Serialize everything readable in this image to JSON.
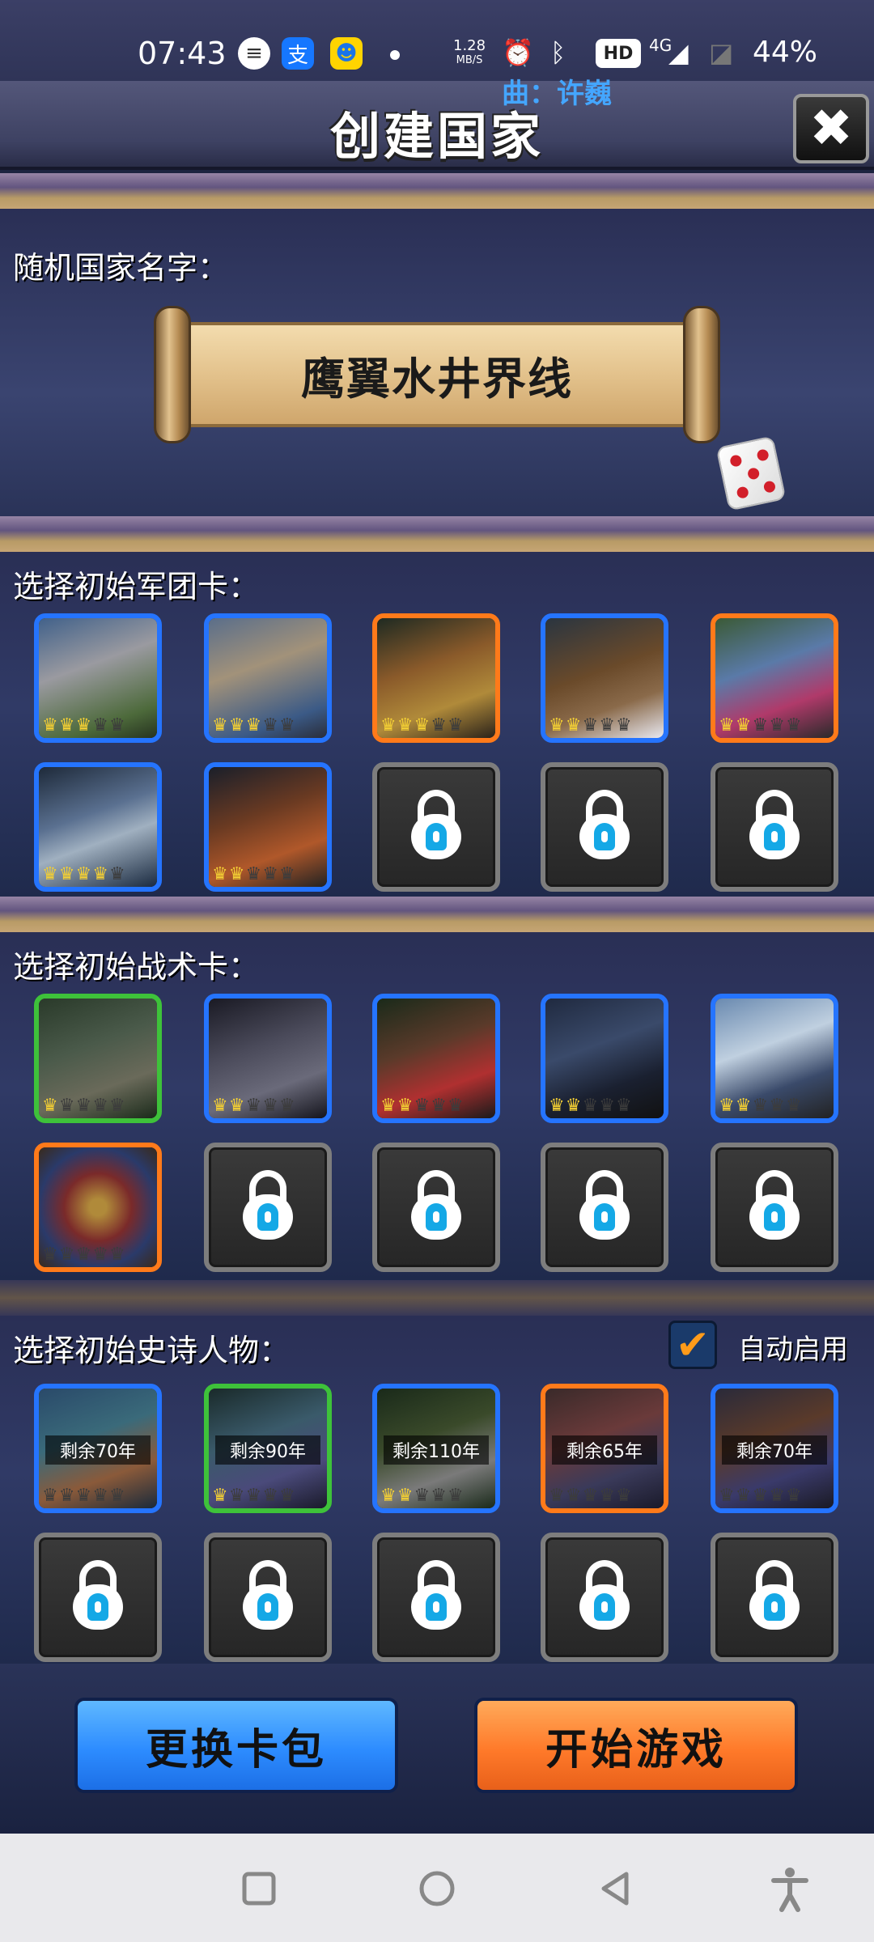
{
  "status_bar": {
    "time": "07:43",
    "speed_value": "1.28",
    "speed_unit": "MB/S",
    "network": "4G",
    "hd": "HD",
    "battery": "44%",
    "app_icons": [
      "message-icon",
      "alipay-icon",
      "qq-icon"
    ]
  },
  "music": "曲：许巍",
  "title": "创建国家",
  "close_label": "✖",
  "name_section": {
    "label": "随机国家名字：",
    "country_name": "鹰翼水井界线"
  },
  "legion_section": {
    "label": "选择初始军团卡：",
    "cards": [
      {
        "rarity": "blue",
        "crowns": 3,
        "art": "knight-on-horse"
      },
      {
        "rarity": "blue",
        "crowns": 3,
        "art": "armored-soldier"
      },
      {
        "rarity": "orange",
        "crowns": 3,
        "art": "cavalry-rider"
      },
      {
        "rarity": "blue",
        "crowns": 2,
        "art": "catapult"
      },
      {
        "rarity": "orange",
        "crowns": 2,
        "art": "archer"
      },
      {
        "rarity": "blue",
        "crowns": 4,
        "art": "dark-warrior"
      },
      {
        "rarity": "blue",
        "crowns": 2,
        "art": "chariot"
      },
      {
        "locked": true
      },
      {
        "locked": true
      },
      {
        "locked": true
      }
    ]
  },
  "tactic_section": {
    "label": "选择初始战术卡：",
    "cards": [
      {
        "rarity": "green",
        "crowns": 1,
        "art": "knights-group"
      },
      {
        "rarity": "blue",
        "crowns": 2,
        "art": "dark-army"
      },
      {
        "rarity": "blue",
        "crowns": 2,
        "art": "barbarian-warrior"
      },
      {
        "rarity": "blue",
        "crowns": 2,
        "art": "soldier-ranks"
      },
      {
        "rarity": "blue",
        "crowns": 2,
        "art": "spear-army"
      },
      {
        "rarity": "orange",
        "crowns": 0,
        "art": "shield"
      },
      {
        "locked": true
      },
      {
        "locked": true
      },
      {
        "locked": true
      },
      {
        "locked": true
      }
    ]
  },
  "hero_section": {
    "label": "选择初始史诗人物：",
    "auto_enable_label": "自动启用",
    "auto_enable_checked": true,
    "cards": [
      {
        "rarity": "blue",
        "crowns": 0,
        "remain": "剩余70年",
        "art": "red-hair-hero"
      },
      {
        "rarity": "green",
        "crowns": 1,
        "remain": "剩余90年",
        "art": "elf-mage"
      },
      {
        "rarity": "blue",
        "crowns": 2,
        "remain": "剩余110年",
        "art": "knight-hero"
      },
      {
        "rarity": "orange",
        "crowns": 0,
        "remain": "剩余65年",
        "art": "general"
      },
      {
        "rarity": "blue",
        "crowns": 0,
        "remain": "剩余70年",
        "art": "warlord"
      },
      {
        "locked": true
      },
      {
        "locked": true
      },
      {
        "locked": true
      },
      {
        "locked": true
      },
      {
        "locked": true
      }
    ]
  },
  "buttons": {
    "change_pack": "更换卡包",
    "start_game": "开始游戏"
  },
  "colors": {
    "blue_rarity": "#2574ff",
    "orange_rarity": "#ff7a1a",
    "green_rarity": "#3ec23a",
    "crown": "#f3cf34",
    "lock_keyhole": "#14a8e6"
  }
}
